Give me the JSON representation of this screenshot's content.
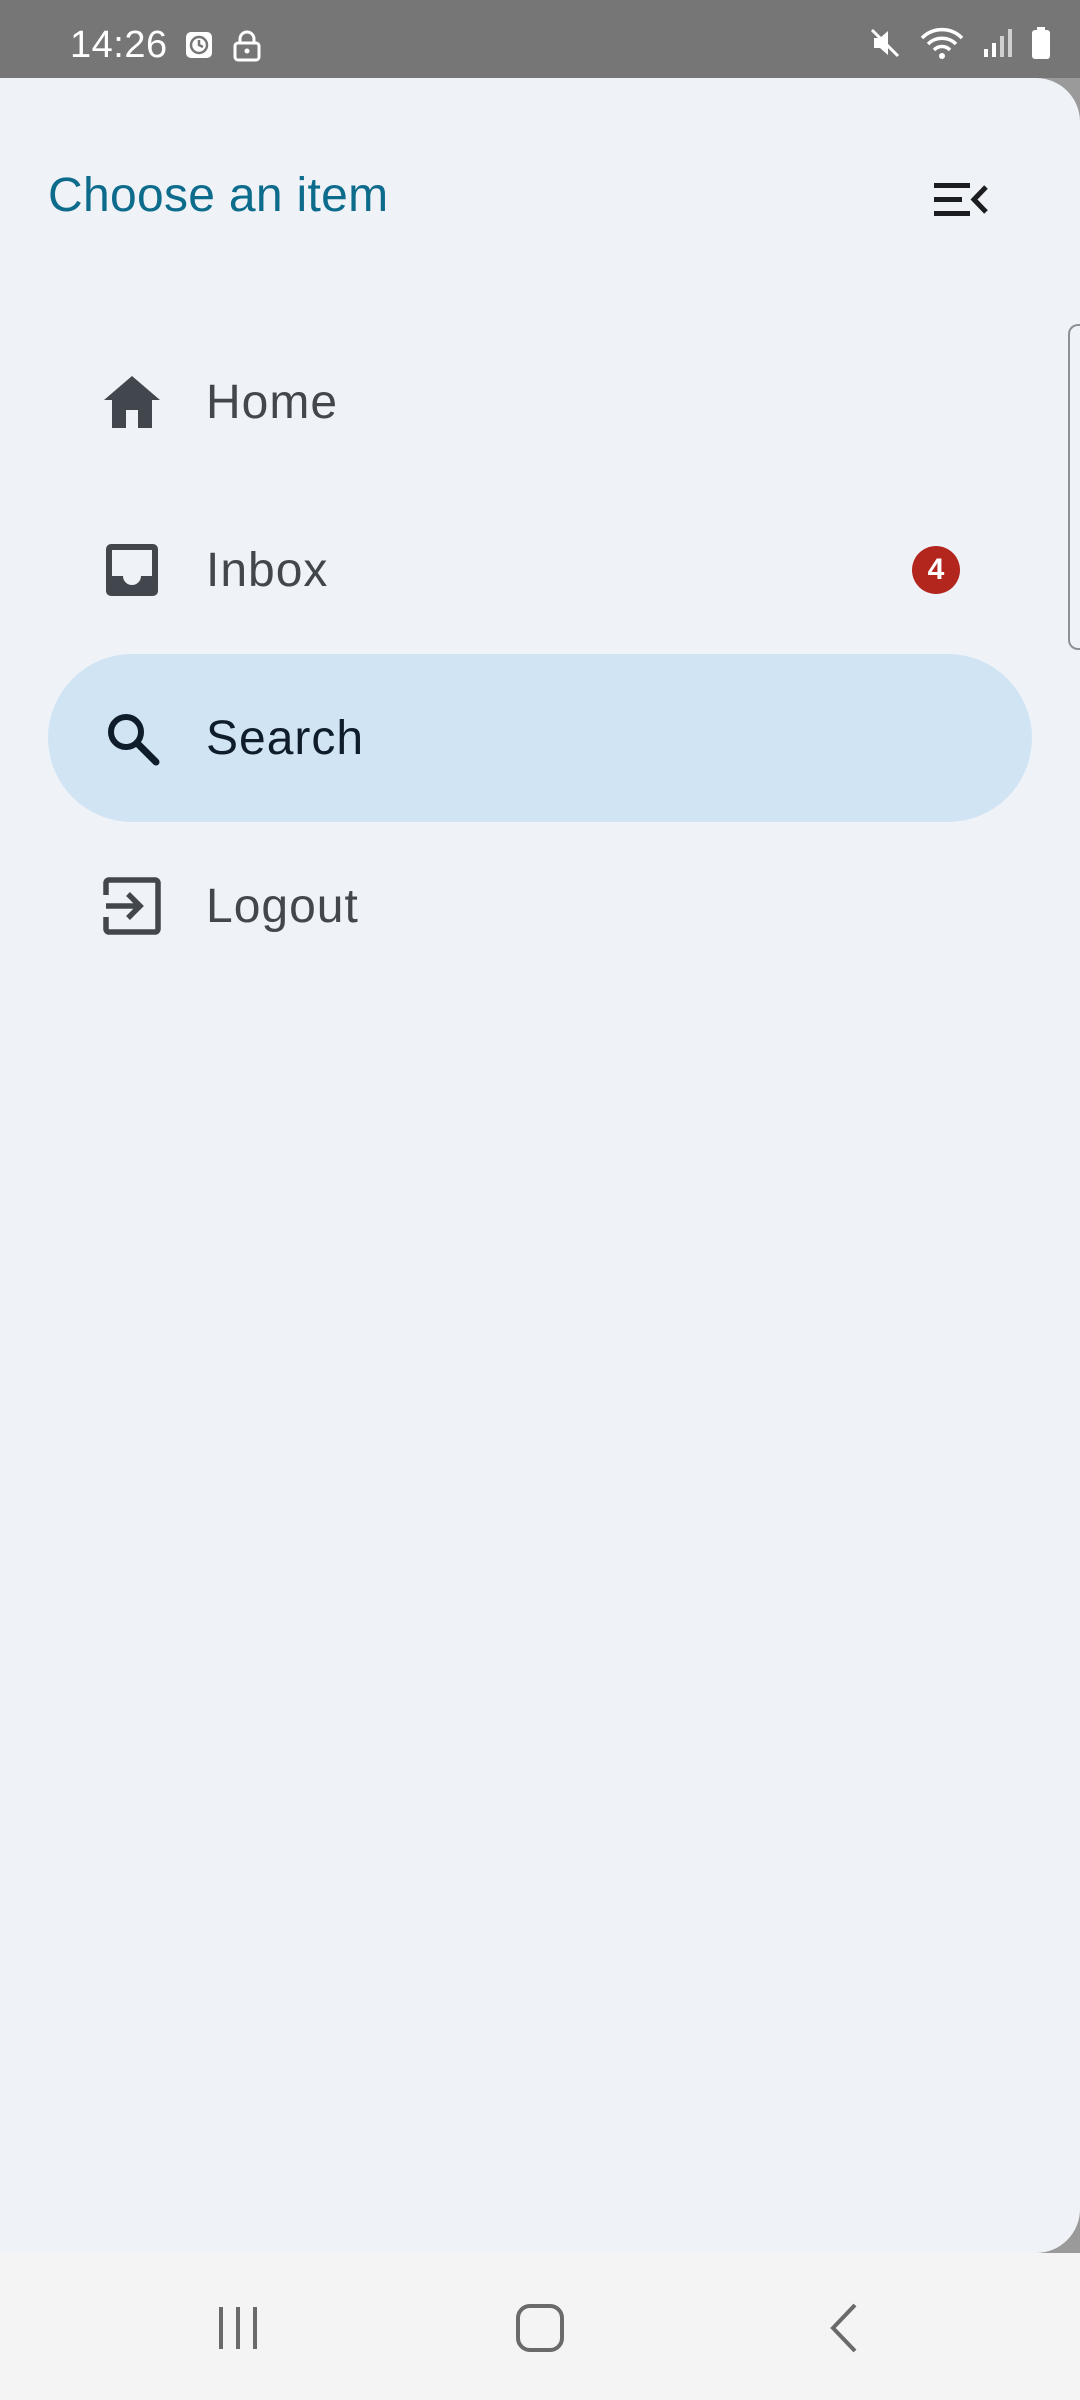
{
  "status_bar": {
    "time": "14:26",
    "left_icons": [
      "alarm-icon",
      "lock-icon"
    ],
    "right_icons": [
      "mute-icon",
      "wifi-icon",
      "signal-icon",
      "battery-icon"
    ]
  },
  "drawer": {
    "title": "Choose an item",
    "toggle_icon": "menu-open-icon",
    "items": [
      {
        "label": "Home",
        "icon": "home-icon",
        "selected": false
      },
      {
        "label": "Inbox",
        "icon": "inbox-icon",
        "selected": false,
        "badge": "4"
      },
      {
        "label": "Search",
        "icon": "search-icon",
        "selected": true
      },
      {
        "label": "Logout",
        "icon": "logout-icon",
        "selected": false
      }
    ]
  },
  "colors": {
    "title": "#0d6b8c",
    "drawer_background": "#eff3f8",
    "selected_item": "#d0e4f4",
    "badge": "#b3261e"
  },
  "system_nav": {
    "buttons": [
      "recents-button",
      "home-button",
      "back-button"
    ]
  }
}
